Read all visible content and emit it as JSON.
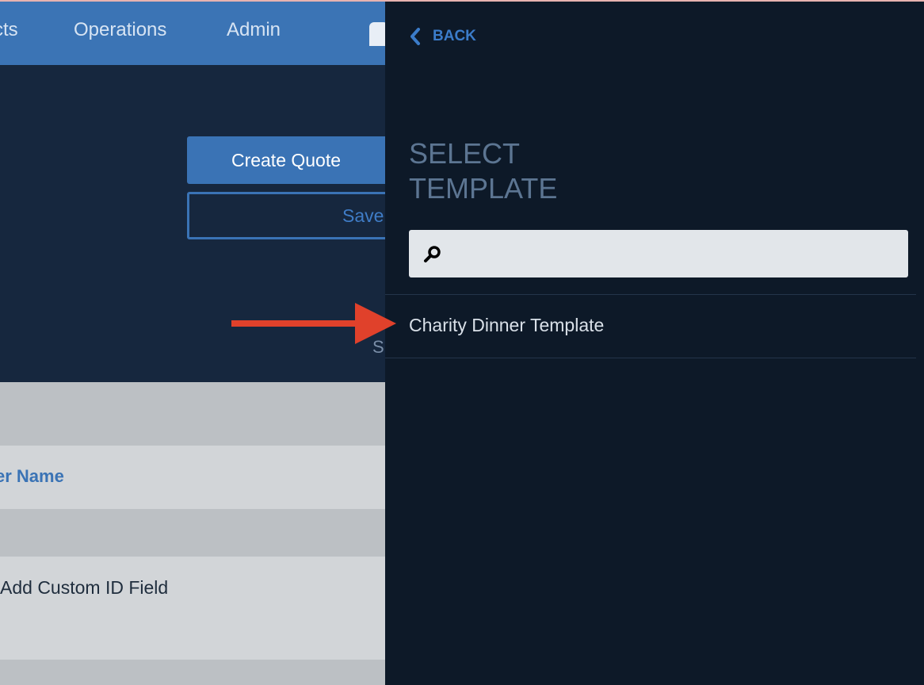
{
  "nav": {
    "partial_item": "cts",
    "operations": "Operations",
    "admin": "Admin"
  },
  "actions": {
    "create_quote": "Create Quote",
    "save": "Save",
    "partial_status": "S"
  },
  "table": {
    "column_header": "er Name",
    "custom_id_link": "Add Custom ID Field"
  },
  "panel": {
    "back_label": "BACK",
    "title": "SELECT TEMPLATE",
    "search_placeholder": "",
    "templates": [
      "Charity Dinner Template"
    ]
  },
  "colors": {
    "nav_blue": "#3b74b5",
    "panel_bg": "#0d1928",
    "accent_blue": "#3b7cc9",
    "annotation_arrow": "#e0412b"
  }
}
